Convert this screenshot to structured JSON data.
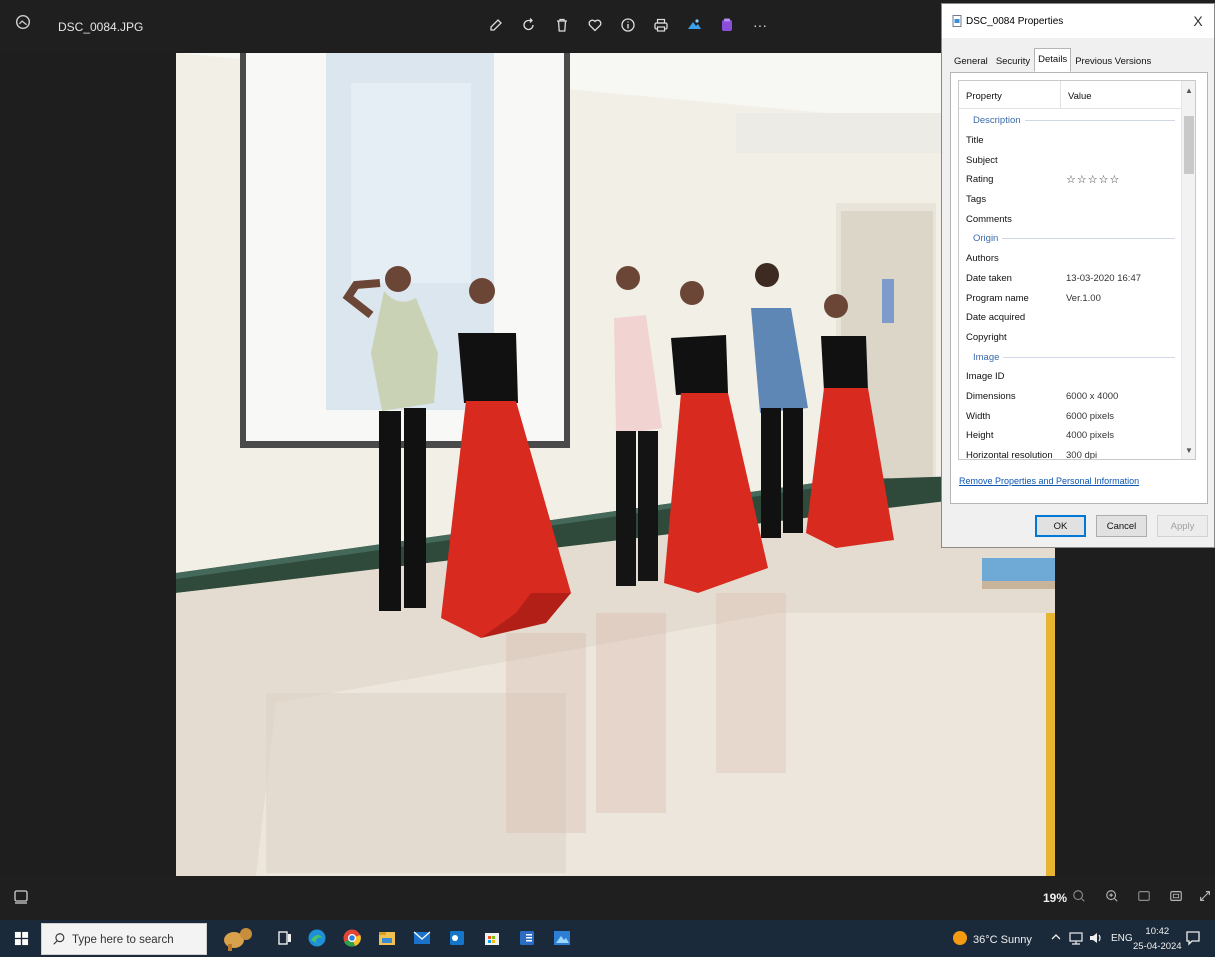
{
  "viewer": {
    "file_name": "DSC_0084.JPG",
    "toolbar_icons": [
      "edit-icon",
      "rotate-icon",
      "delete-icon",
      "favorite-icon",
      "info-icon",
      "print-icon",
      "edit-app-icon",
      "clipchamp-icon",
      "more-icon"
    ],
    "more_label": "···",
    "zoom_level": "19%"
  },
  "dialog": {
    "title": "DSC_0084 Properties",
    "close_label": "X",
    "tabs": [
      "General",
      "Security",
      "Details",
      "Previous Versions"
    ],
    "active_tab": "Details",
    "columns": {
      "property": "Property",
      "value": "Value"
    },
    "rows": [
      {
        "type": "section",
        "label": "Description"
      },
      {
        "type": "row",
        "label": "Title",
        "value": ""
      },
      {
        "type": "row",
        "label": "Subject",
        "value": ""
      },
      {
        "type": "row",
        "label": "Rating",
        "value": "☆☆☆☆☆"
      },
      {
        "type": "row",
        "label": "Tags",
        "value": ""
      },
      {
        "type": "row",
        "label": "Comments",
        "value": ""
      },
      {
        "type": "section",
        "label": "Origin"
      },
      {
        "type": "row",
        "label": "Authors",
        "value": ""
      },
      {
        "type": "row",
        "label": "Date taken",
        "value": "13-03-2020 16:47"
      },
      {
        "type": "row",
        "label": "Program name",
        "value": "Ver.1.00"
      },
      {
        "type": "row",
        "label": "Date acquired",
        "value": ""
      },
      {
        "type": "row",
        "label": "Copyright",
        "value": ""
      },
      {
        "type": "section",
        "label": "Image"
      },
      {
        "type": "row",
        "label": "Image ID",
        "value": ""
      },
      {
        "type": "row",
        "label": "Dimensions",
        "value": "6000 x 4000"
      },
      {
        "type": "row",
        "label": "Width",
        "value": "6000 pixels"
      },
      {
        "type": "row",
        "label": "Height",
        "value": "4000 pixels"
      },
      {
        "type": "row",
        "label": "Horizontal resolution",
        "value": "300 dpi"
      }
    ],
    "remove_link": "Remove Properties and Personal Information",
    "buttons": {
      "ok": "OK",
      "cancel": "Cancel",
      "apply": "Apply"
    }
  },
  "taskbar": {
    "search_placeholder": "Type here to search",
    "weather": "36°C  Sunny",
    "language": "ENG",
    "time": "10:42",
    "date": "25-04-2024"
  },
  "colors": {
    "accent": "#0078d7",
    "taskbar": "#1b2a3a",
    "viewer_bg": "#1f1f1f"
  }
}
